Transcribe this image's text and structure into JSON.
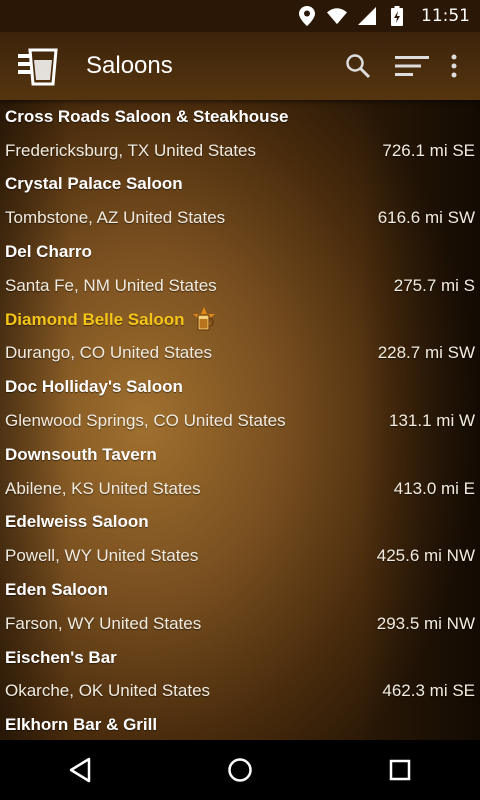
{
  "status_bar": {
    "time": "11:51",
    "icons": [
      "location-icon",
      "wifi-icon",
      "signal-icon",
      "battery-charging-icon"
    ]
  },
  "app_bar": {
    "title": "Saloons",
    "icons": [
      "drink-logo-icon",
      "search-icon",
      "sort-icon",
      "overflow-menu-icon"
    ]
  },
  "colors": {
    "highlight": "#f5c518",
    "appbar": "#4a2d0d",
    "background": "#7a5020"
  },
  "saloons": [
    {
      "name": "Cross Roads Saloon & Steakhouse",
      "location": "Fredericksburg, TX United States",
      "distance": "726.1 mi SE",
      "highlighted": false
    },
    {
      "name": "Crystal Palace Saloon",
      "location": "Tombstone, AZ United States",
      "distance": "616.6 mi SW",
      "highlighted": false
    },
    {
      "name": "Del Charro",
      "location": "Santa Fe, NM United States",
      "distance": "275.7 mi S",
      "highlighted": false
    },
    {
      "name": "Diamond Belle Saloon",
      "location": "Durango, CO United States",
      "distance": "228.7 mi SW",
      "highlighted": true
    },
    {
      "name": "Doc Holliday's Saloon",
      "location": "Glenwood Springs, CO United States",
      "distance": "131.1 mi W",
      "highlighted": false
    },
    {
      "name": "Downsouth Tavern",
      "location": "Abilene, KS United States",
      "distance": "413.0 mi E",
      "highlighted": false
    },
    {
      "name": "Edelweiss Saloon",
      "location": "Powell, WY United States",
      "distance": "425.6 mi NW",
      "highlighted": false
    },
    {
      "name": "Eden Saloon",
      "location": "Farson, WY United States",
      "distance": "293.5 mi NW",
      "highlighted": false
    },
    {
      "name": "Eischen's Bar",
      "location": "Okarche, OK United States",
      "distance": "462.3 mi SE",
      "highlighted": false
    },
    {
      "name": "Elkhorn Bar & Grill",
      "location": "",
      "distance": "",
      "highlighted": false
    }
  ],
  "nav_bar": {
    "icons": [
      "back-icon",
      "home-icon",
      "recents-icon"
    ]
  }
}
